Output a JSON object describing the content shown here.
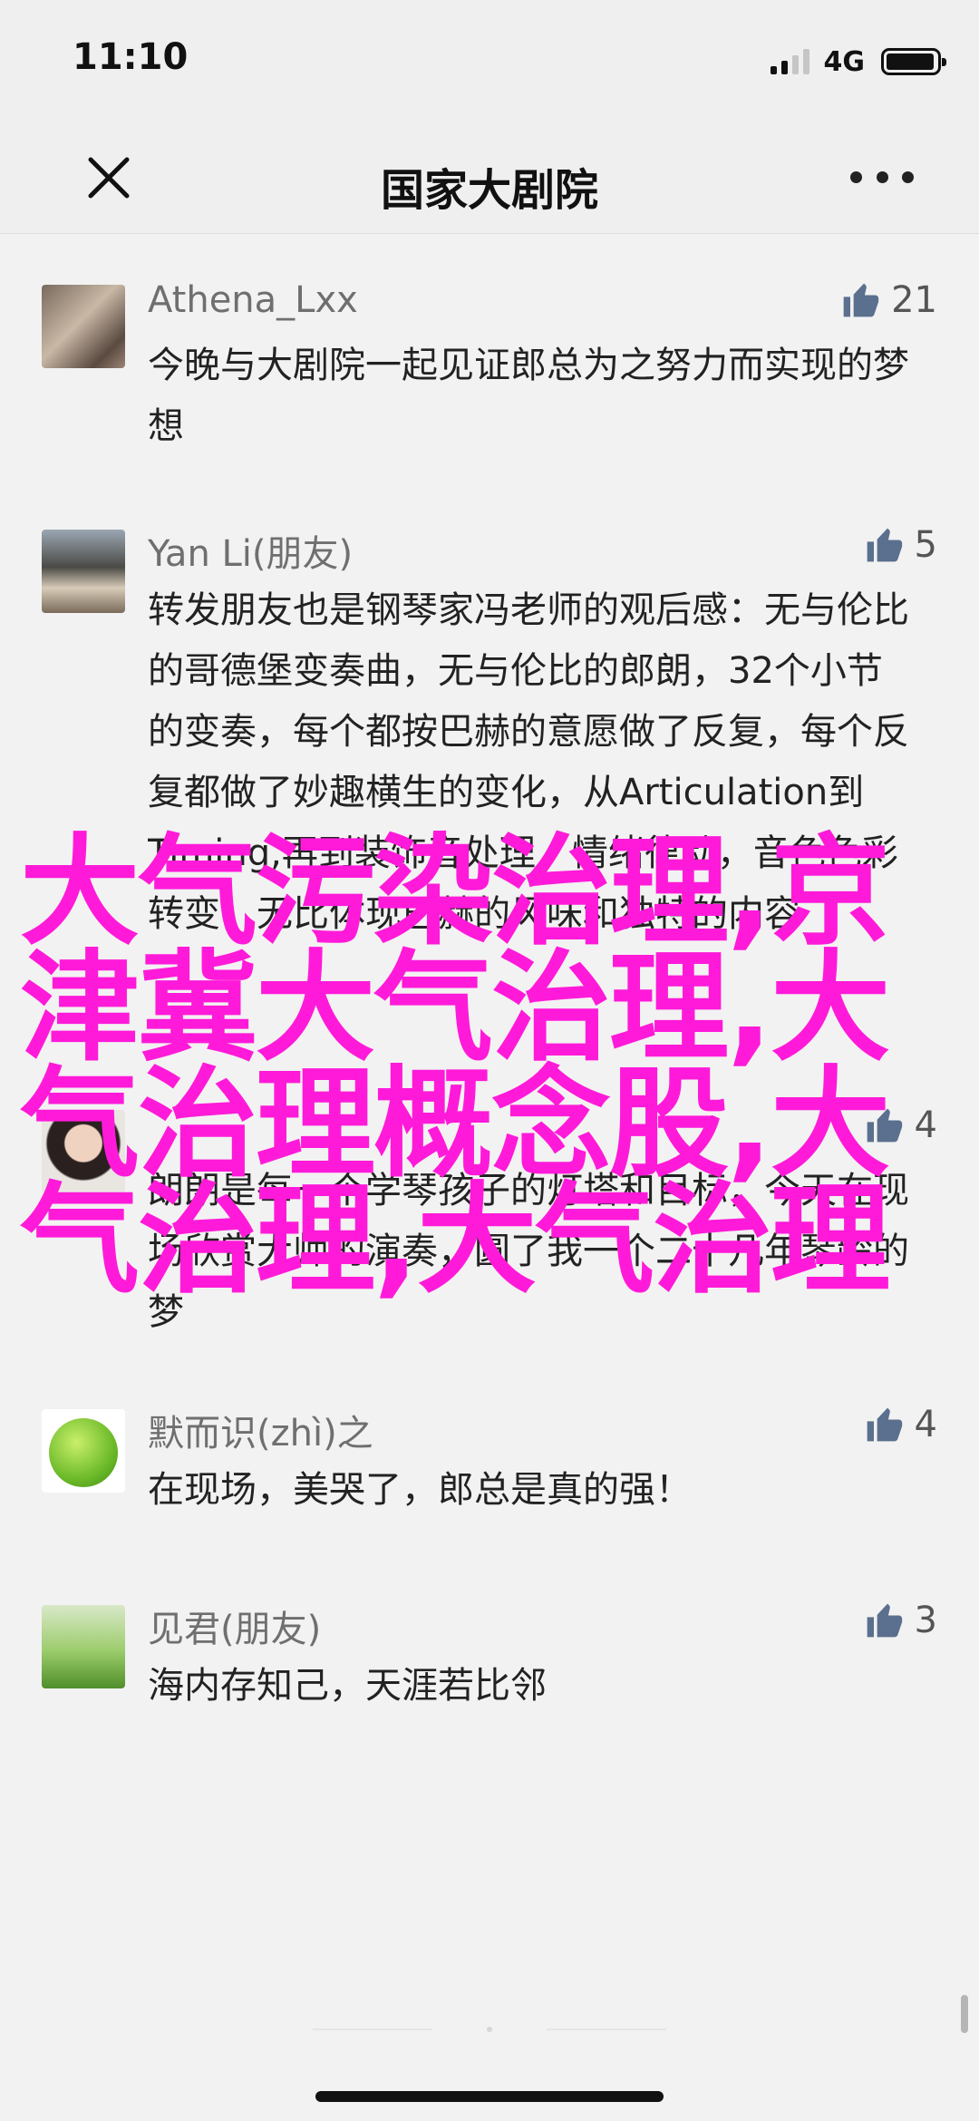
{
  "status_bar": {
    "time": "11:10",
    "network": "4G"
  },
  "nav": {
    "title": "国家大剧院",
    "close_icon": "close-icon",
    "more_icon": "more-icon"
  },
  "comments": [
    {
      "name": "Athena_Lxx",
      "text": "今晚与大剧院一起见证郎总为之努力而实现的梦想",
      "likes": "21"
    },
    {
      "name": "Yan Li(朋友)",
      "text": "转发朋友也是钢琴家冯老师的观后感：无与伦比的哥德堡变奏曲，无与伦比的郎朗，32个小节的变奏，每个都按巴赫的意愿做了反复，每个反复都做了妙趣横生的变化，从Articulation到Timing,再到装饰音处理，情绪律动，音色色彩转变，无比体现巴赫的风味和独特的内容",
      "likes": "5"
    },
    {
      "name": "",
      "text": "朗朗是每一个学琴孩子的灯塔和目标，今天在现场欣赏大师的演奏，圆了我一个二十几年琴龄的梦",
      "likes": "4"
    },
    {
      "name": "默而识(zhì)之",
      "text": "在现场，美哭了，郎总是真的强！",
      "likes": "4"
    },
    {
      "name": "见君(朋友)",
      "text": "海内存知己，天涯若比邻",
      "likes": "3"
    }
  ],
  "overlay_text": "大气污染治理,京津冀大气治理,大气治理概念股,大气治理,大气治理",
  "colors": {
    "overlay": "#ff1ad9",
    "like_icon": "#5b6f8e"
  }
}
